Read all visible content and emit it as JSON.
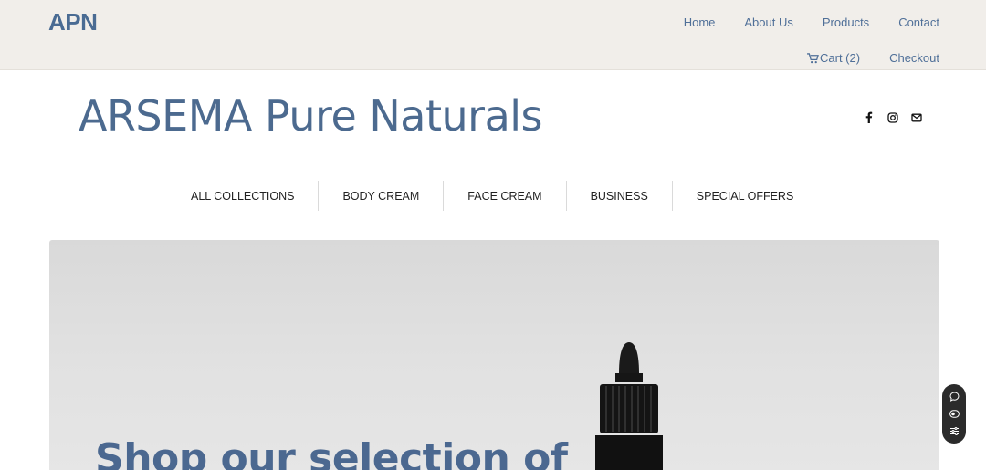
{
  "header": {
    "logo": "APN",
    "nav_primary": [
      "Home",
      "About Us",
      "Products",
      "Contact"
    ],
    "cart_label": "Cart (2)",
    "checkout_label": "Checkout"
  },
  "brand": {
    "title": "ARSEMA Pure Naturals",
    "social_icons": [
      "facebook-icon",
      "instagram-icon",
      "mail-icon"
    ]
  },
  "categories": [
    "ALL COLLECTIONS",
    "BODY CREAM",
    "FACE CREAM",
    "BUSINESS",
    "SPECIAL OFFERS"
  ],
  "hero": {
    "headline": "Shop our selection of"
  },
  "widget": {
    "icons": [
      "chat-icon",
      "toggle-icon",
      "settings-icon"
    ]
  },
  "colors": {
    "accent": "#4b6890",
    "topbar_bg": "#f1eeea"
  }
}
